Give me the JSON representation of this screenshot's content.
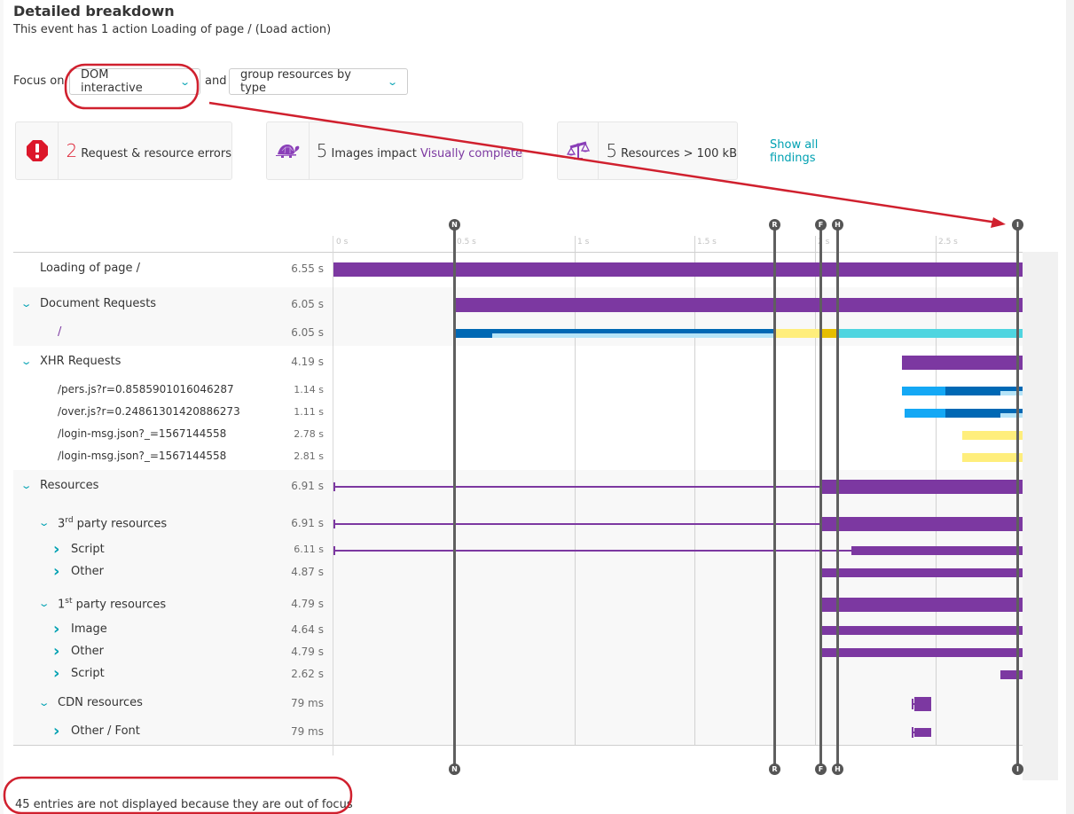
{
  "header": {
    "title": "Detailed breakdown",
    "subtitle": "This event has 1 action Loading of page / (Load action)"
  },
  "controls": {
    "focus_label": "Focus on",
    "focus_value": "DOM interactive",
    "and_label": "and",
    "group_value": "group resources by type"
  },
  "findings": [
    {
      "icon": "error-octagon-icon",
      "count": "2",
      "text": "Request & resource errors",
      "link": "",
      "color": "#dc172a"
    },
    {
      "icon": "turtle-icon",
      "count": "5",
      "text": "Images impact ",
      "link": "Visually complete",
      "color": "#7c38a1"
    },
    {
      "icon": "scale-icon",
      "count": "5",
      "text": "Resources > 100 kB",
      "link": "",
      "color": "#7c38a1"
    }
  ],
  "show_all_findings": "Show all findings",
  "footer": "45 entries are not displayed because they are out of focus",
  "colors": {
    "purple": "#7c38a1",
    "dark_blue": "#0068b4",
    "light_blue": "#b5e4f8",
    "mid_blue": "#14a8f5",
    "yellow": "#ffee7c",
    "gold": "#e6be00",
    "cyan": "#4fd5e0",
    "teal_accent": "#00a1b2",
    "annotation_red": "#d0202e"
  },
  "chart_data": {
    "type": "gantt-waterfall",
    "x_unit": "s",
    "x_range": [
      0,
      2.86
    ],
    "ticks": [
      {
        "v": 0,
        "label": "0 s"
      },
      {
        "v": 0.5,
        "label": "0.5 s"
      },
      {
        "v": 1,
        "label": "1 s"
      },
      {
        "v": 1.5,
        "label": "1.5 s"
      },
      {
        "v": 2,
        "label": "2 s"
      },
      {
        "v": 2.5,
        "label": "2.5 s"
      }
    ],
    "markers": [
      {
        "id": "N",
        "t": 0.5
      },
      {
        "id": "R",
        "t": 1.83
      },
      {
        "id": "F",
        "t": 2.02
      },
      {
        "id": "H",
        "t": 2.09
      },
      {
        "id": "I",
        "t": 2.84
      }
    ],
    "rows": [
      {
        "label": "Loading of page /",
        "duration": "6.55 s",
        "level": 0,
        "toggle": "",
        "shade": false,
        "tall": true,
        "segments": [
          {
            "start": 0,
            "end": 2.86,
            "color": "purple"
          }
        ]
      },
      {
        "label": "Document Requests",
        "duration": "6.05 s",
        "level": 0,
        "toggle": "down",
        "shade": true,
        "tall": true,
        "segments": [
          {
            "start": 0.5,
            "end": 2.86,
            "color": "purple"
          }
        ]
      },
      {
        "label": "/",
        "duration": "6.05 s",
        "level": 2,
        "toggle": "",
        "shade": true,
        "tall": false,
        "purple": true,
        "segments": [
          {
            "start": 0.5,
            "end": 0.66,
            "color": "dark_blue"
          },
          {
            "start": 0.66,
            "end": 1.83,
            "color": "dark_blue",
            "half": "top"
          },
          {
            "start": 0.66,
            "end": 1.83,
            "color": "light_blue",
            "half": "bottom"
          },
          {
            "start": 1.83,
            "end": 2.02,
            "color": "yellow"
          },
          {
            "start": 2.02,
            "end": 2.09,
            "color": "gold"
          },
          {
            "start": 2.09,
            "end": 2.86,
            "color": "cyan"
          }
        ]
      },
      {
        "label": "XHR Requests",
        "duration": "4.19 s",
        "level": 0,
        "toggle": "down",
        "shade": false,
        "tall": true,
        "segments": [
          {
            "start": 2.36,
            "end": 2.86,
            "color": "purple"
          }
        ]
      },
      {
        "label": "/pers.js?r=0.8585901016046287",
        "duration": "1.14 s",
        "level": 2,
        "toggle": "",
        "shade": false,
        "small": true,
        "segments": [
          {
            "start": 2.36,
            "end": 2.54,
            "color": "mid_blue"
          },
          {
            "start": 2.54,
            "end": 2.86,
            "color": "dark_blue",
            "half": "top"
          },
          {
            "start": 2.54,
            "end": 2.77,
            "color": "dark_blue",
            "half": "bottom"
          },
          {
            "start": 2.77,
            "end": 2.86,
            "color": "light_blue",
            "half": "bottom"
          }
        ]
      },
      {
        "label": "/over.js?r=0.24861301420886273",
        "duration": "1.11 s",
        "level": 2,
        "toggle": "",
        "shade": false,
        "small": true,
        "segments": [
          {
            "start": 2.37,
            "end": 2.54,
            "color": "mid_blue"
          },
          {
            "start": 2.54,
            "end": 2.86,
            "color": "dark_blue",
            "half": "top"
          },
          {
            "start": 2.54,
            "end": 2.77,
            "color": "dark_blue",
            "half": "bottom"
          },
          {
            "start": 2.77,
            "end": 2.86,
            "color": "light_blue",
            "half": "bottom"
          }
        ]
      },
      {
        "label": "/login-msg.json?_=1567144558",
        "duration": "2.78 s",
        "level": 2,
        "toggle": "",
        "shade": false,
        "small": true,
        "segments": [
          {
            "start": 2.61,
            "end": 2.86,
            "color": "yellow"
          }
        ]
      },
      {
        "label": "/login-msg.json?_=1567144558",
        "duration": "2.81 s",
        "level": 2,
        "toggle": "",
        "shade": false,
        "small": true,
        "segments": [
          {
            "start": 2.61,
            "end": 2.86,
            "color": "yellow"
          }
        ]
      },
      {
        "label": "Resources",
        "duration": "6.91 s",
        "level": 0,
        "toggle": "down",
        "shade": true,
        "tall": true,
        "whisker": 0,
        "segments": [
          {
            "start": 2.03,
            "end": 2.86,
            "color": "purple"
          }
        ]
      },
      {
        "label": "party resources",
        "sup": "rd",
        "prefix": "3",
        "duration": "6.91 s",
        "level": 1,
        "toggle": "down",
        "shade": true,
        "tall": true,
        "whisker": 0,
        "segments": [
          {
            "start": 2.03,
            "end": 2.86,
            "color": "purple"
          }
        ]
      },
      {
        "label": "Script",
        "duration": "6.11 s",
        "level": 2,
        "toggle": "right",
        "shade": true,
        "small_dur": true,
        "whisker": 0,
        "segments": [
          {
            "start": 2.15,
            "end": 2.86,
            "color": "purple"
          }
        ]
      },
      {
        "label": "Other",
        "duration": "4.87 s",
        "level": 2,
        "toggle": "right",
        "shade": true,
        "segments": [
          {
            "start": 2.03,
            "end": 2.86,
            "color": "purple"
          }
        ]
      },
      {
        "label": "party resources",
        "sup": "st",
        "prefix": "1",
        "duration": "4.79 s",
        "level": 1,
        "toggle": "down",
        "shade": true,
        "tall": true,
        "segments": [
          {
            "start": 2.03,
            "end": 2.86,
            "color": "purple"
          }
        ]
      },
      {
        "label": "Image",
        "duration": "4.64 s",
        "level": 2,
        "toggle": "right",
        "shade": true,
        "segments": [
          {
            "start": 2.03,
            "end": 2.86,
            "color": "purple"
          }
        ]
      },
      {
        "label": "Other",
        "duration": "4.79 s",
        "level": 2,
        "toggle": "right",
        "shade": true,
        "segments": [
          {
            "start": 2.03,
            "end": 2.86,
            "color": "purple"
          }
        ]
      },
      {
        "label": "Script",
        "duration": "2.62 s",
        "level": 2,
        "toggle": "right",
        "shade": true,
        "segments": [
          {
            "start": 2.77,
            "end": 2.86,
            "color": "purple"
          }
        ]
      },
      {
        "label": "CDN resources",
        "duration": "79 ms",
        "level": 1,
        "toggle": "down",
        "shade": true,
        "tall": true,
        "cap": 2.4,
        "segments": [
          {
            "start": 2.41,
            "end": 2.48,
            "color": "purple"
          }
        ]
      },
      {
        "label": "Other / Font",
        "duration": "79 ms",
        "level": 2,
        "toggle": "right",
        "shade": true,
        "cap": 2.4,
        "segments": [
          {
            "start": 2.41,
            "end": 2.48,
            "color": "purple"
          }
        ]
      }
    ]
  }
}
